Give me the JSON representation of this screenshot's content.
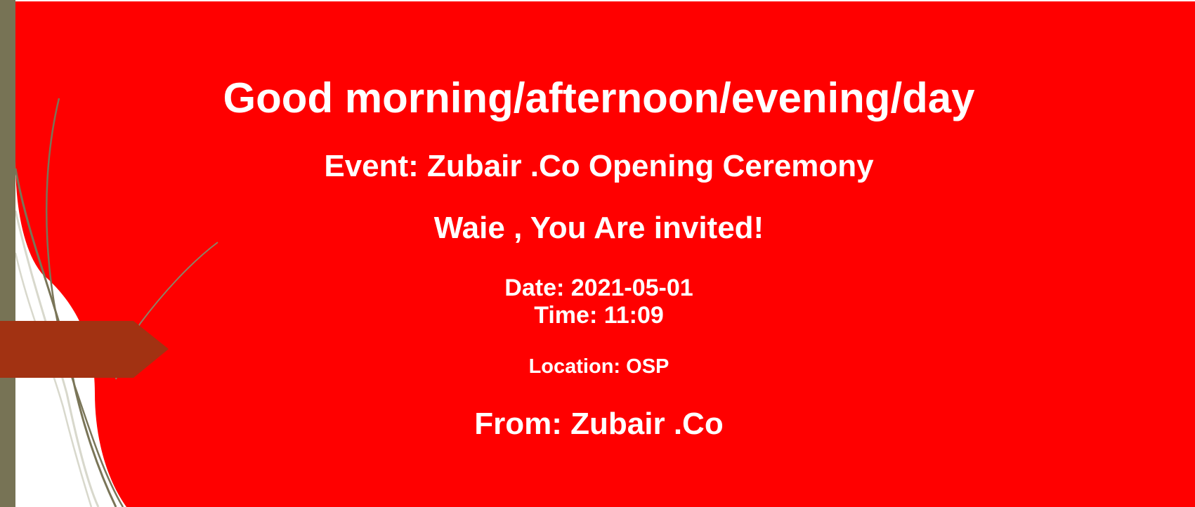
{
  "invitation": {
    "greeting": "Good morning/afternoon/evening/day",
    "event": "Event: Zubair .Co Opening Ceremony",
    "invite": "Waie , You Are invited!",
    "date": "Date: 2021-05-01",
    "time": "Time: 11:09",
    "location": "Location: OSP",
    "from": "From: Zubair .Co"
  },
  "colors": {
    "background": "#ff0000",
    "text": "#ffffff",
    "sidebar": "#777355",
    "arrow_tab": "#a23212",
    "curves": "#7a7558",
    "curves_light": "#d8d8cc"
  }
}
